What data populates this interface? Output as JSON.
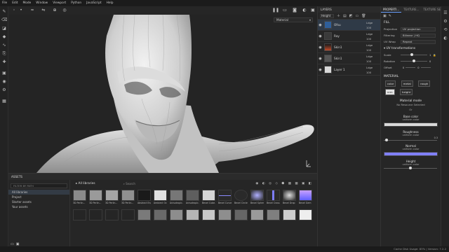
{
  "menu": [
    "File",
    "Edit",
    "Mode",
    "Window",
    "Viewport",
    "Python",
    "JavaScript",
    "Help"
  ],
  "viewport": {
    "material_select": "Material"
  },
  "layers_panel": {
    "title": "LAYERS",
    "channel_select": "Height",
    "layers": [
      {
        "name": "Ofsu",
        "blend": "Ldge",
        "opacity": "100",
        "selected": true
      },
      {
        "name": "Ray",
        "blend": "Ldge",
        "opacity": "100",
        "selected": false
      },
      {
        "name": "Skin1",
        "blend": "Ldge",
        "opacity": "100",
        "selected": false
      },
      {
        "name": "Skin1",
        "blend": "Ldge",
        "opacity": "100",
        "selected": false
      },
      {
        "name": "Layer 1",
        "blend": "Ldge",
        "opacity": "100",
        "selected": false
      }
    ]
  },
  "properties": {
    "tabs": [
      "PROPERTI...",
      "TEXTURE...",
      "TEXTURE SET..."
    ],
    "fill_title": "FILL",
    "projection_label": "Projection",
    "projection_value": "UV projection",
    "filtering_label": "Filtering",
    "filtering_value": "Bilinear | HQ",
    "uvwrap_label": "UV Wrap",
    "uvwrap_value": "Repeat",
    "uv_transform_title": "UV transformations",
    "scale_label": "Scale",
    "scale_value": "1",
    "rotation_label": "Rotation",
    "rotation_value": "0",
    "offset_label": "Offset",
    "offset_values": [
      "0",
      "0"
    ],
    "material_title": "MATERIAL",
    "channel_buttons": [
      {
        "label": "color",
        "active": false
      },
      {
        "label": "metal",
        "active": false
      },
      {
        "label": "rough",
        "active": false
      },
      {
        "label": "nrm",
        "active": true
      },
      {
        "label": "height",
        "active": false
      }
    ],
    "material_mode": "Material mode",
    "no_resource": "No Resource Selected",
    "or_label": "Or",
    "channels": [
      {
        "title": "Base color",
        "sub": "uniform color",
        "swatch": "#d9d9d9"
      },
      {
        "title": "Roughness",
        "sub": "uniform color",
        "value": "0.3",
        "swatch": "#4a4a4a"
      },
      {
        "title": "Normal",
        "sub": "uniform color",
        "swatch": "#8080ff"
      },
      {
        "title": "Height",
        "sub": "uniform color",
        "swatch": "#d9d9d9"
      }
    ]
  },
  "assets": {
    "title": "ASSETS",
    "filter_placeholder": "FILTER BY PATH",
    "tree": [
      "All libraries",
      "Project",
      "Starter assets",
      "Your assets"
    ],
    "breadcrumb": "All libraries",
    "search_placeholder": "Search",
    "tiles_row1": [
      "3D Perlin...",
      "3D Perlin...",
      "3D Perlin...",
      "3D Perlin...",
      "Abstract Eng...",
      "Ambient Occl...",
      "Anisotropic...",
      "Anisotropic...",
      "Bevel Cube...",
      "Bevel Curve",
      "Bevel Circle",
      "Bevel Sphere",
      "Bevel Cross",
      "Bevel Drop",
      "Bevel Gem",
      "Bevel Line"
    ],
    "tiles_row2": [
      "",
      "",
      "",
      "",
      "",
      "",
      "",
      "",
      "",
      "",
      "",
      "",
      "",
      "",
      "",
      ""
    ]
  },
  "status": "Cache Disk Usage:   83%  |  Version: 7.2.2"
}
